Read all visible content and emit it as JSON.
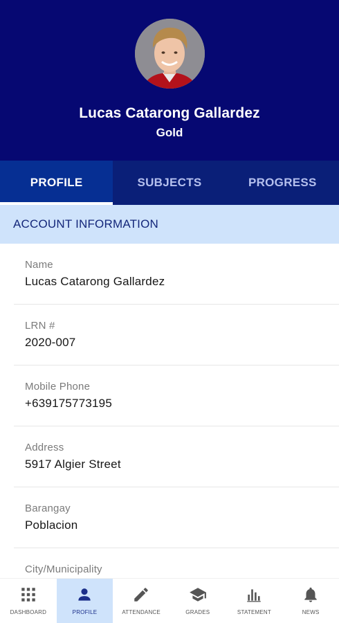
{
  "profile": {
    "name": "Lucas Catarong Gallardez",
    "level": "Gold"
  },
  "tabs": [
    {
      "label": "PROFILE",
      "active": true
    },
    {
      "label": "SUBJECTS",
      "active": false
    },
    {
      "label": "PROGRESS",
      "active": false
    }
  ],
  "section": {
    "title": "ACCOUNT INFORMATION"
  },
  "fields": [
    {
      "label": "Name",
      "value": "Lucas Catarong Gallardez"
    },
    {
      "label": "LRN #",
      "value": "2020-007"
    },
    {
      "label": "Mobile Phone",
      "value": "+639175773195"
    },
    {
      "label": "Address",
      "value": "5917 Algier Street"
    },
    {
      "label": "Barangay",
      "value": "Poblacion"
    },
    {
      "label": "City/Municipality",
      "value": ""
    }
  ],
  "bottom_nav": [
    {
      "label": "DASHBOARD",
      "icon": "grid-icon",
      "active": false
    },
    {
      "label": "PROFILE",
      "icon": "person-icon",
      "active": true
    },
    {
      "label": "ATTENDANCE",
      "icon": "pencil-icon",
      "active": false
    },
    {
      "label": "GRADES",
      "icon": "graduation-cap-icon",
      "active": false
    },
    {
      "label": "STATEMENT",
      "icon": "bar-chart-icon",
      "active": false
    },
    {
      "label": "NEWS",
      "icon": "bell-icon",
      "active": false
    }
  ],
  "colors": {
    "header_bg": "#060872",
    "tabs_bg": "#0a1f78",
    "active_tab_bg": "#062f93",
    "section_bg": "#cfe3fb",
    "nav_active_bg": "#cfe3fb"
  }
}
